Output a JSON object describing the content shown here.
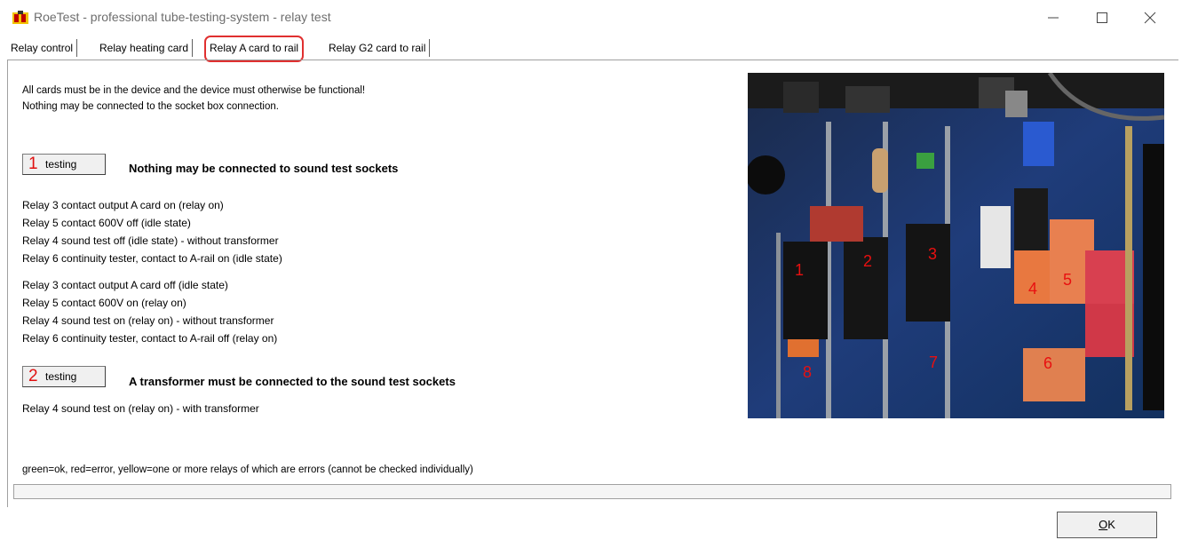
{
  "window": {
    "title": "RoeTest - professional tube-testing-system - relay test"
  },
  "tabs": [
    {
      "label": "Relay control"
    },
    {
      "label": "Relay heating card"
    },
    {
      "label": "Relay A card to rail"
    },
    {
      "label": "Relay G2 card to rail"
    }
  ],
  "active_tab": "Relay A card to rail",
  "info": [
    "All cards must be in the device and the device must otherwise be functional!",
    "Nothing may be connected to the socket box connection."
  ],
  "test1": {
    "number": "1",
    "button": "testing",
    "heading": "Nothing may be connected to sound test sockets",
    "lines": [
      "Relay 3 contact output A card on (relay on)",
      "Relay 5 contact 600V off (idle state)",
      "Relay 4 sound test off (idle state) - without transformer",
      "Relay 6 continuity tester, contact to A-rail on (idle state)",
      "Relay 3 contact output A card off (idle state)",
      "Relay 5 contact 600V on (relay on)",
      "Relay 4 sound test on (relay on) - without transformer",
      "Relay 6 continuity tester, contact to A-rail off (relay on)"
    ]
  },
  "test2": {
    "number": "2",
    "button": "testing",
    "heading": "A transformer must be connected to the sound test sockets",
    "lines": [
      "Relay 4 sound test on (relay on) - with transformer"
    ]
  },
  "photo_markers": [
    "1",
    "2",
    "3",
    "4",
    "5",
    "6",
    "7",
    "8"
  ],
  "legend": "green=ok, red=error, yellow=one or more relays of which are errors (cannot be checked individually)",
  "ok_button": {
    "pre": "",
    "accel": "O",
    "post": "K"
  },
  "colors": {
    "marker_red": "#e81010",
    "tab_highlight": "#e03030"
  }
}
